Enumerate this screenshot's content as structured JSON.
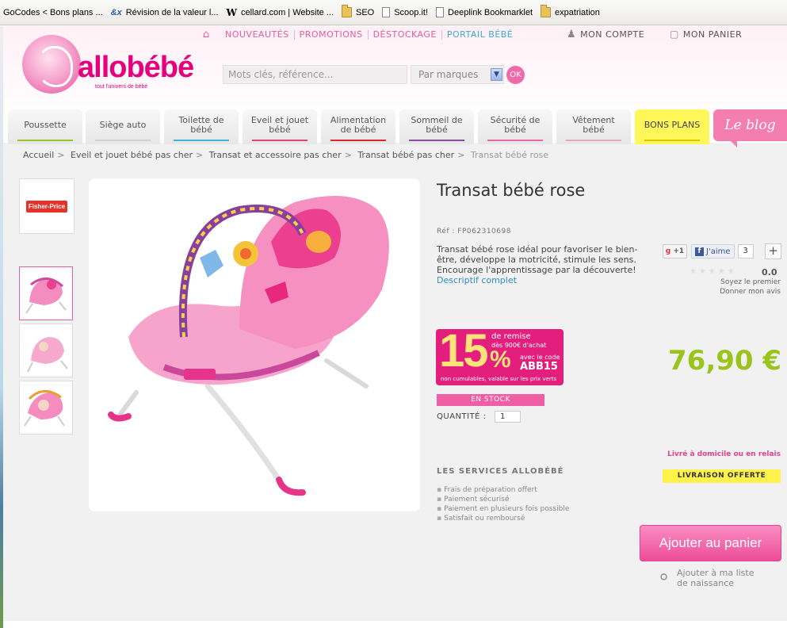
{
  "bookmarks": [
    {
      "label": "GoCodes < Bons plans ...",
      "icon": "none"
    },
    {
      "label": "Révision de la valeur l...",
      "icon": "ex-icon"
    },
    {
      "label": "cellard.com | Website ...",
      "icon": "w-icon"
    },
    {
      "label": "SEO",
      "icon": "folder-icon"
    },
    {
      "label": "Scoop.it!",
      "icon": "page-icon"
    },
    {
      "label": "Deeplink Bookmarklet",
      "icon": "page-icon"
    },
    {
      "label": "expatriation",
      "icon": "folder-icon"
    }
  ],
  "topnav": {
    "links": [
      "NOUVEAUTÉS",
      "PROMOTIONS",
      "DÉSTOCKAGE",
      "PORTAIL BÉBÉ"
    ],
    "account": "MON COMPTE",
    "cart": "MON PANIER"
  },
  "logo": {
    "brand": "allobébé",
    "tagline": "tout l'univers de bébé"
  },
  "search": {
    "placeholder": "Mots clés, référence...",
    "select_value": "Par marques",
    "ok_label": "OK"
  },
  "categories": [
    {
      "label": "Poussette",
      "color": "#9bc42a"
    },
    {
      "label": "Siège auto",
      "color": "#d0d0d0"
    },
    {
      "label": "Toilette de bébé",
      "color": "#43b5dd"
    },
    {
      "label": "Eveil et jouet bébé",
      "color": "#e0446f"
    },
    {
      "label": "Alimentation de bébé",
      "color": "#e2262f"
    },
    {
      "label": "Sommeil de bébé",
      "color": "#8b4ea3"
    },
    {
      "label": "Sécurité de bébé",
      "color": "#e96aa7"
    },
    {
      "label": "Vêtement bébé",
      "color": "#e8a6c4"
    },
    {
      "label": "BONS PLANS",
      "color": "#d8c800"
    }
  ],
  "blog_label": "Le blog",
  "breadcrumb": [
    "Accueil",
    "Eveil et jouet bébé pas cher",
    "Transat et accessoire pas cher",
    "Transat bébé pas cher",
    "Transat bébé rose"
  ],
  "brand_logo": "Fisher-Price",
  "product": {
    "title": "Transat bébé rose",
    "ref": "Réf : FP062310698",
    "description": "Transat bébé rose idéal pour favoriser le bien-être, développe la motricité, stimule les sens.",
    "description2": "Encourage l'apprentissage par la découverte!",
    "link": "Descriptif complet",
    "price": "76,90 €",
    "stock": "EN STOCK",
    "qty_label": "QUANTITÉ :",
    "qty_value": "1"
  },
  "social": {
    "gplus": "+1",
    "fb_label": "J'aime",
    "fb_count": "3",
    "plus": "+"
  },
  "rating": {
    "value": "0.0",
    "stars": 0,
    "line1": "Soyez le premier",
    "line2": "Donner mon avis"
  },
  "promo": {
    "big": "15",
    "pct": "%",
    "line1": "de remise",
    "line2": "dès 900€ d'achat",
    "line3": "avec le code",
    "code": "ABB15",
    "line4": "non cumulables, valable sur les prix verts"
  },
  "delivery": {
    "text": "Livré à domicile ou en relais",
    "badge": "LIVRAISON OFFERTE"
  },
  "services": {
    "title": "LES SERVICES ALLOBÉBÉ",
    "items": [
      "Frais de préparation offert",
      "Paiement sécurisé",
      "Paiement en plusieurs fois possible",
      "Satisfait ou remboursé"
    ]
  },
  "cart_button": "Ajouter au panier",
  "wishlist": {
    "line1": "Ajouter à ma liste",
    "line2": "de naissance"
  },
  "colors": {
    "pink": "#e6007e",
    "price_green": "#9ac31c",
    "accent": "#f05ea6"
  }
}
